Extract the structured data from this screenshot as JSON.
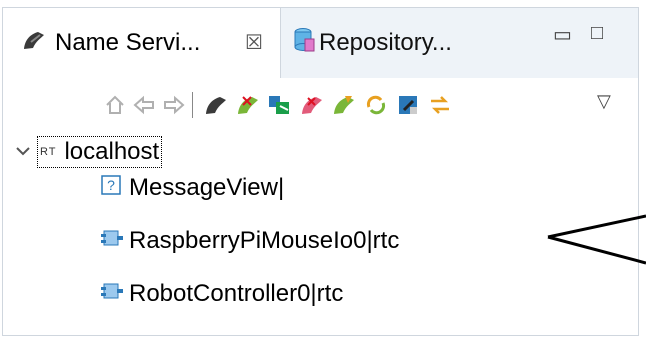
{
  "tabs": [
    {
      "label": "Name Servi...",
      "icon": "name-service-icon",
      "active": true,
      "close_glyph": "☒"
    },
    {
      "label": "Repository...",
      "icon": "repository-icon",
      "active": false
    }
  ],
  "window_controls": {
    "minimize": "▭",
    "maximize": "□"
  },
  "toolbar": {
    "buttons": [
      "home-icon",
      "back-icon",
      "forward-icon",
      "name-server-icon",
      "add-name-server-icon",
      "add-manager-icon",
      "add-component-icon",
      "delete-icon",
      "refresh-icon",
      "edit-icon",
      "connect-icon"
    ],
    "menu_glyph": "▽"
  },
  "tree": {
    "root": {
      "label": "localhost",
      "prefix": "RT",
      "expanded": true
    },
    "children": [
      {
        "label": "MessageView|",
        "icon": "unknown-icon"
      },
      {
        "label": "RaspberryPiMouseIo0|rtc",
        "icon": "rtc-component-icon"
      },
      {
        "label": "RobotController0|rtc",
        "icon": "rtc-component-icon"
      }
    ]
  },
  "colors": {
    "tab_bar": "#eef3f8",
    "border": "#cfd6de",
    "selection_border": "#000000"
  }
}
